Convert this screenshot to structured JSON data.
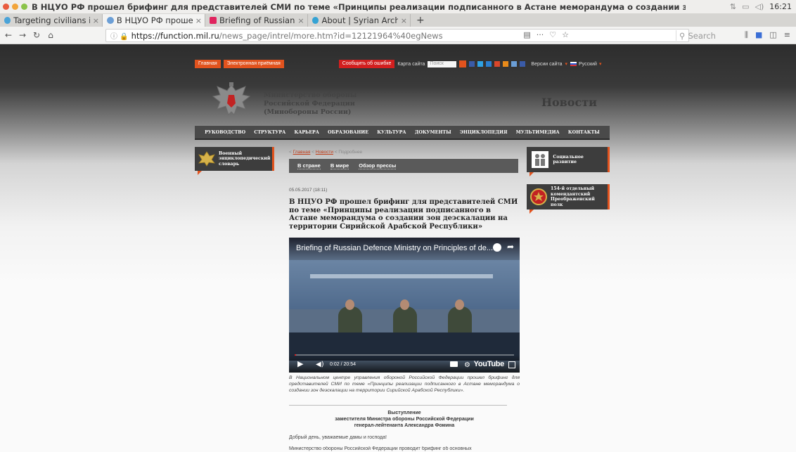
{
  "window": {
    "title": "В НЦУО РФ прошел брифинг для представителей СМИ по теме «Принципы реализации подписанного в Астане меморандума о создании зон деэскалации на территории С",
    "clock": "16:21"
  },
  "tabs": [
    {
      "label": "Targeting civilians in",
      "color": "#4aa3d8"
    },
    {
      "label": "В НЦУО РФ проше",
      "color": "#6c9fd6"
    },
    {
      "label": "Briefing of Russian",
      "color": "#e0245e"
    },
    {
      "label": "About | Syrian Archi",
      "color": "#35a3d4"
    }
  ],
  "nav": {
    "url_host": "https://function.mil.ru",
    "url_path": "/news_page/intrel/more.htm?id=12121964%40egNews",
    "search_placeholder": "Search",
    "more": "···"
  },
  "site": {
    "top_links": {
      "home": "Главная",
      "reception": "Электронная приёмная",
      "report_error": "Сообщить об ошибке",
      "sitemap": "Карта сайта",
      "search_placeholder": "Поиск",
      "versions": "Версии сайта",
      "language": "Русский"
    },
    "ministry_lines": [
      "Министерство обороны",
      "Российской Федерации",
      "(Минобороны России)"
    ],
    "section_title": "Новости",
    "main_nav": [
      "РУКОВОДСТВО",
      "СТРУКТУРА",
      "КАРЬЕРА",
      "ОБРАЗОВАНИЕ",
      "КУЛЬТУРА",
      "ДОКУМЕНТЫ",
      "ЭНЦИКЛОПЕДИЯ",
      "МУЛЬТИМЕДИА",
      "КОНТАКТЫ"
    ],
    "left_box": "Военный энциклопедический словарь",
    "right_boxes": [
      "Социальное развитие",
      "154-й отдельный комендантский Преображенский полк"
    ],
    "breadcrumbs": {
      "home": "Главная",
      "news": "Новости",
      "current": "Подробнее",
      "sep": "<"
    },
    "subtabs": [
      "В стране",
      "В мире",
      "Обзор прессы"
    ]
  },
  "article": {
    "date": "05.05.2017 (18:11)",
    "headline": "В НЦУО РФ прошел брифинг для представителей СМИ по теме «Принципы реализации подписанного в Астане меморандума о создании зон деэскалации на территории Сирийской Арабской Республики»",
    "video": {
      "title": "Briefing of Russian Defence Ministry on Principles of de...",
      "time": "0:02 / 20:54",
      "brand": "YouTube",
      "progress": 0.002
    },
    "caption": "В Национальном центре управления обороной Российской Федерации прошел брифинг для представителей СМИ по теме «Принципы реализации подписанного в Астане меморандума о создании зон деэскалации на территории Сирийской Арабской Республики».",
    "speech_heading": "Выступление",
    "speech_line2": "заместителя Министра обороны Российской Федерации",
    "speech_line3": "генерал-лейтенанта Александра Фомина",
    "greeting": "Добрый день, уважаемые дамы и господа!",
    "paragraph_start": "Министерство обороны Российской Федерации проводит брифинг об основных"
  }
}
